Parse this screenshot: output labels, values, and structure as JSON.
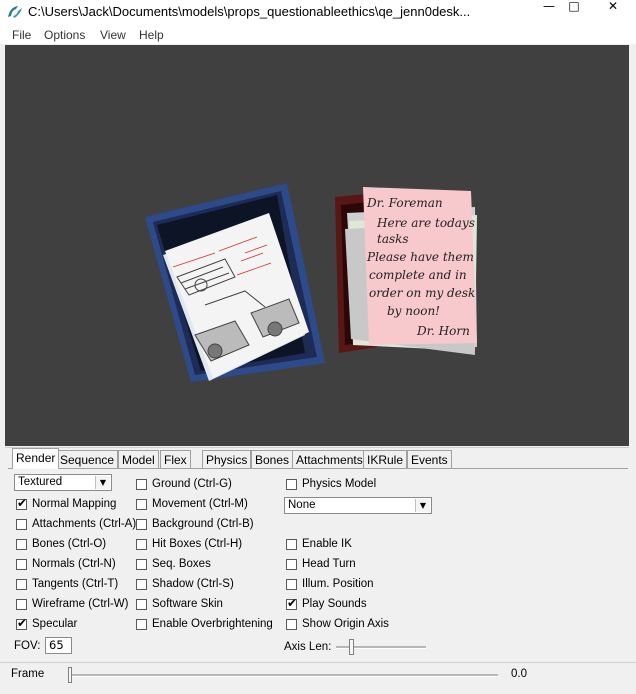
{
  "window": {
    "title": "C:\\Users\\Jack\\Documents\\models\\props_questionableethics\\qe_jenn0desk..."
  },
  "menu": [
    "File",
    "Options",
    "View",
    "Help"
  ],
  "viewport": {
    "background": "#404040",
    "note_text": {
      "line1": "Dr. Foreman",
      "line2": "Here are todays",
      "line3": "tasks",
      "line4": "Please have them",
      "line5": "complete and in",
      "line6": "order on my desk",
      "line7": "by noon!",
      "line8": "Dr. Horn"
    }
  },
  "tabs": [
    "Render",
    "Sequence",
    "Model",
    "Flex",
    "Physics",
    "Bones",
    "Attachments",
    "IKRule",
    "Events"
  ],
  "render": {
    "render_mode": "Textured",
    "col1": [
      {
        "label": "Normal Mapping",
        "checked": true
      },
      {
        "label": "Attachments (Ctrl-A)",
        "checked": false
      },
      {
        "label": "Bones (Ctrl-O)",
        "checked": false
      },
      {
        "label": "Normals (Ctrl-N)",
        "checked": false
      },
      {
        "label": "Tangents (Ctrl-T)",
        "checked": false
      },
      {
        "label": "Wireframe (Ctrl-W)",
        "checked": false
      },
      {
        "label": "Specular",
        "checked": true
      }
    ],
    "col2": [
      {
        "label": "Ground (Ctrl-G)",
        "checked": false
      },
      {
        "label": "Movement (Ctrl-M)",
        "checked": false
      },
      {
        "label": "Background (Ctrl-B)",
        "checked": false
      },
      {
        "label": "Hit Boxes (Ctrl-H)",
        "checked": false
      },
      {
        "label": "Seq. Boxes",
        "checked": false
      },
      {
        "label": "Shadow (Ctrl-S)",
        "checked": false
      },
      {
        "label": "Software Skin",
        "checked": false
      },
      {
        "label": "Enable Overbrightening",
        "checked": false
      }
    ],
    "physics_model": {
      "label": "Physics Model",
      "checked": false
    },
    "physics_select": "None",
    "col3": [
      {
        "label": "Enable IK",
        "checked": false
      },
      {
        "label": "Head Turn",
        "checked": false
      },
      {
        "label": "Illum. Position",
        "checked": false
      },
      {
        "label": "Play Sounds",
        "checked": true
      },
      {
        "label": "Show Origin Axis",
        "checked": false
      }
    ],
    "fov_label": "FOV:",
    "fov_value": "65",
    "axis_len_label": "Axis Len:"
  },
  "frame": {
    "label": "Frame",
    "value": "0.0"
  }
}
